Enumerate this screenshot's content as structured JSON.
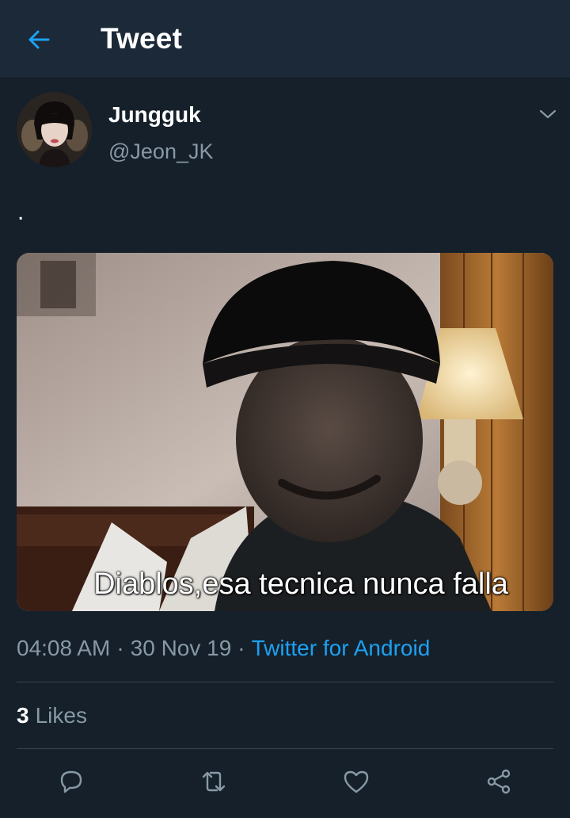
{
  "header": {
    "title": "Tweet",
    "back_icon": "arrow-left-icon",
    "accent": "#1da1f2"
  },
  "author": {
    "name": "Jungguk",
    "handle": "@Jeon_JK"
  },
  "tweet": {
    "text": ".",
    "media_caption": "Diablos,esa tecnica nunca falla",
    "time": "04:08 AM",
    "separator": "·",
    "date": "30 Nov 19",
    "client": "Twitter for Android"
  },
  "stats": {
    "likes_count": "3",
    "likes_label": "Likes"
  },
  "actions": [
    {
      "icon": "reply-icon"
    },
    {
      "icon": "retweet-icon"
    },
    {
      "icon": "like-icon"
    },
    {
      "icon": "share-icon"
    }
  ],
  "colors": {
    "background": "#15202b",
    "header": "#1c2938",
    "muted_text": "#8899a6",
    "link": "#1da1f2",
    "divider": "#38444d"
  }
}
